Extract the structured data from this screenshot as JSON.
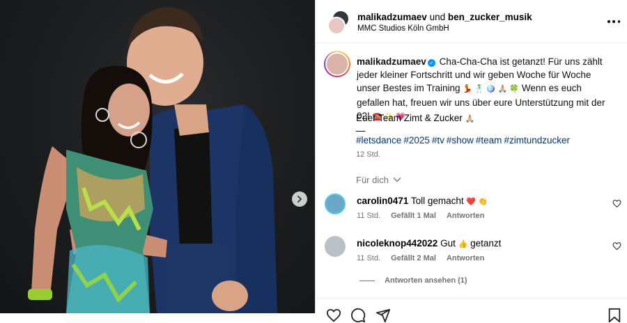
{
  "header": {
    "user_primary": "malikadzumaev",
    "connector": "und",
    "user_secondary": "ben_zucker_musik",
    "location": "MMC Studios Köln GmbH"
  },
  "caption": {
    "user": "malikadzumaev",
    "text": "Cha-Cha-Cha ist getanzt! Für uns zählt jeder kleiner Fortschritt und wir geben Woche für Woche unser Bestes im Training",
    "emojis_1": "💃 🕺 🪩 🙏🏼 🍀",
    "text_2": "Wenn es euch gefallen hat, freuen wir uns über eure Unterstützung mit der 02!",
    "emojis_2": "☎️ ✨ 💗",
    "signoff": "Euer Team Zimt & Zucker",
    "signoff_emoji": "🙏🏼",
    "dash": "—",
    "hashtags": [
      "#letsdance",
      "#2025",
      "#tv",
      "#show",
      "#team",
      "#zimtundzucker"
    ],
    "time": "12 Std."
  },
  "section": {
    "for_you": "Für dich"
  },
  "comments": [
    {
      "user": "carolin0471",
      "text": "Toll gemacht",
      "emojis": "❤️ 👏",
      "time": "11 Std.",
      "likes": "Gefällt 1 Mal",
      "reply": "Antworten"
    },
    {
      "user": "nicoleknop442022",
      "text": "Gut",
      "emojis": "👍",
      "text_after": "getanzt",
      "time": "11 Std.",
      "likes": "Gefällt 2 Mal",
      "reply": "Antworten"
    }
  ],
  "view_replies": "Antworten ansehen (1)",
  "icons": {
    "verified": "verified-badge-icon",
    "more": "more-options-icon",
    "next": "chevron-right-icon",
    "heart": "heart-icon",
    "comment": "comment-icon",
    "share": "share-icon",
    "save": "bookmark-icon"
  },
  "colors": {
    "link": "#00376b",
    "muted": "#737373",
    "verified": "#0095f6"
  }
}
